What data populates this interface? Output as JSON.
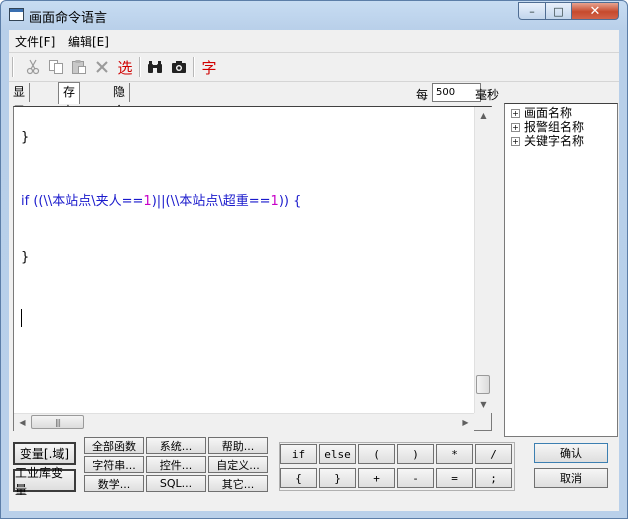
{
  "window": {
    "title": "画面命令语言",
    "controls": {
      "minimize": "–",
      "maximize": "□",
      "close": "✕"
    }
  },
  "menu": {
    "file": "文件[F]",
    "edit": "编辑[E]"
  },
  "toolbar": {
    "cut_icon": "cut-icon",
    "copy_icon": "copy-icon",
    "paste_icon": "paste-icon",
    "delete_icon": "delete-icon",
    "select_label": "选",
    "find_icon": "binoculars-icon",
    "replace_icon": "camera-icon",
    "font_label": "字"
  },
  "tabs": {
    "display": "显示时",
    "exist": "存在时",
    "hidden": "隐含时"
  },
  "interval": {
    "label": "每",
    "value": "500",
    "unit": "毫秒"
  },
  "code": {
    "line1": "}",
    "line2_if": "if",
    "line2_a": " ((\\\\本站点\\夹人==",
    "line2_n1": "1",
    "line2_b": ")||(\\\\本站点\\超重==",
    "line2_n2": "1",
    "line2_c": ")) {",
    "line3": "}"
  },
  "tree": {
    "items": [
      "画面名称",
      "报警组名称",
      "关键字名称"
    ]
  },
  "bottom_buttons": {
    "variable": "变量[.域]",
    "industrial_var": "工业库变量",
    "all_functions": "全部函数",
    "system": "系统...",
    "help": "帮助...",
    "string": "字符串...",
    "control": "控件...",
    "custom": "自定义...",
    "math": "数学...",
    "sql": "SQL...",
    "other": "其它..."
  },
  "operators": {
    "row1": [
      "if",
      "else",
      "(",
      ")",
      "*",
      "/"
    ],
    "row2": [
      "{",
      "}",
      "+",
      "-",
      "=",
      ";"
    ]
  },
  "dialog_buttons": {
    "ok": "确认",
    "cancel": "取消"
  },
  "colors": {
    "keyword": "#1a1acc",
    "number": "#c800c8",
    "title_bar": "#b9d0ea",
    "close_button": "#c64a2d"
  }
}
